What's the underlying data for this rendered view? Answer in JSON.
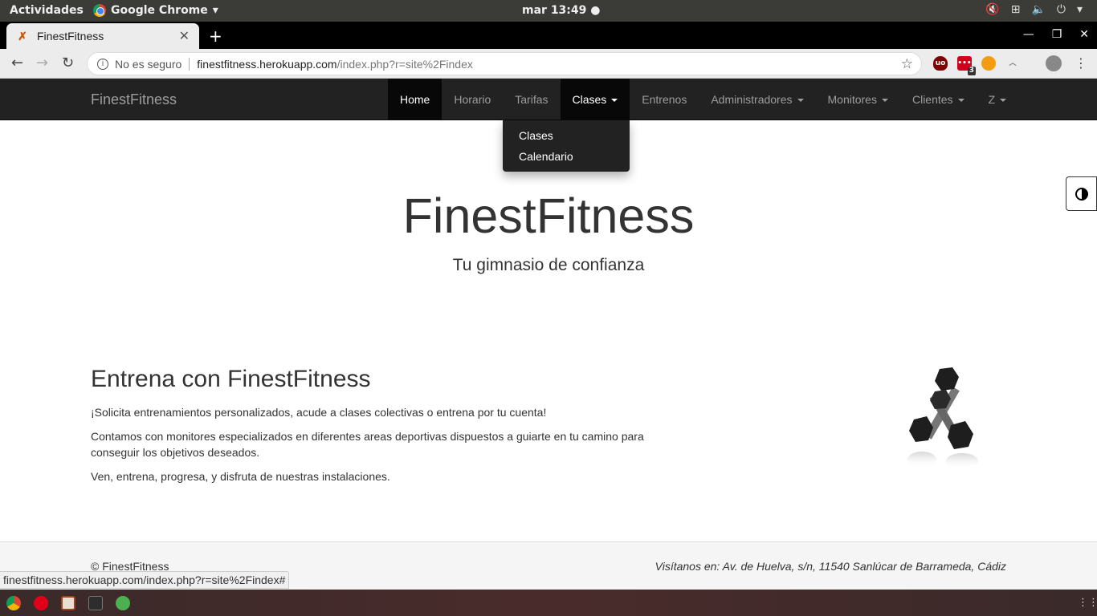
{
  "system": {
    "activities": "Actividades",
    "app_name": "Google Chrome",
    "clock": "mar 13:49 ●"
  },
  "browser": {
    "tab_title": "FinestFitness",
    "security_label": "No es seguro",
    "url_host": "finestfitness.herokuapp.com",
    "url_path": "/index.php?r=site%2Findex",
    "extension_badge": "3",
    "status_url": "finestfitness.herokuapp.com/index.php?r=site%2Findex#"
  },
  "navbar": {
    "brand": "FinestFitness",
    "items": [
      {
        "label": "Home"
      },
      {
        "label": "Horario"
      },
      {
        "label": "Tarifas"
      },
      {
        "label": "Clases"
      },
      {
        "label": "Entrenos"
      },
      {
        "label": "Administradores"
      },
      {
        "label": "Monitores"
      },
      {
        "label": "Clientes"
      },
      {
        "label": "Z"
      }
    ],
    "dropdown": [
      "Clases",
      "Calendario"
    ]
  },
  "hero": {
    "title": "FinestFitness",
    "subtitle": "Tu gimnasio de confianza"
  },
  "content": {
    "heading": "Entrena con FinestFitness",
    "p1": "¡Solicita entrenamientos personalizados, acude a clases colectivas o entrena por tu cuenta!",
    "p2": "Contamos con monitores especializados en diferentes areas deportivas dispuestos a guiarte en tu camino para conseguir los objetivos deseados.",
    "p3": "Ven, entrena, progresa, y disfruta de nuestras instalaciones."
  },
  "footer": {
    "copyright": "© FinestFitness",
    "address": "Visítanos en: Av. de Huelva, s/n, 11540 Sanlúcar de Barrameda, Cádiz"
  },
  "colors": {
    "navbar_bg": "#222222",
    "active_bg": "#080808",
    "nav_text": "#9d9d9d"
  }
}
